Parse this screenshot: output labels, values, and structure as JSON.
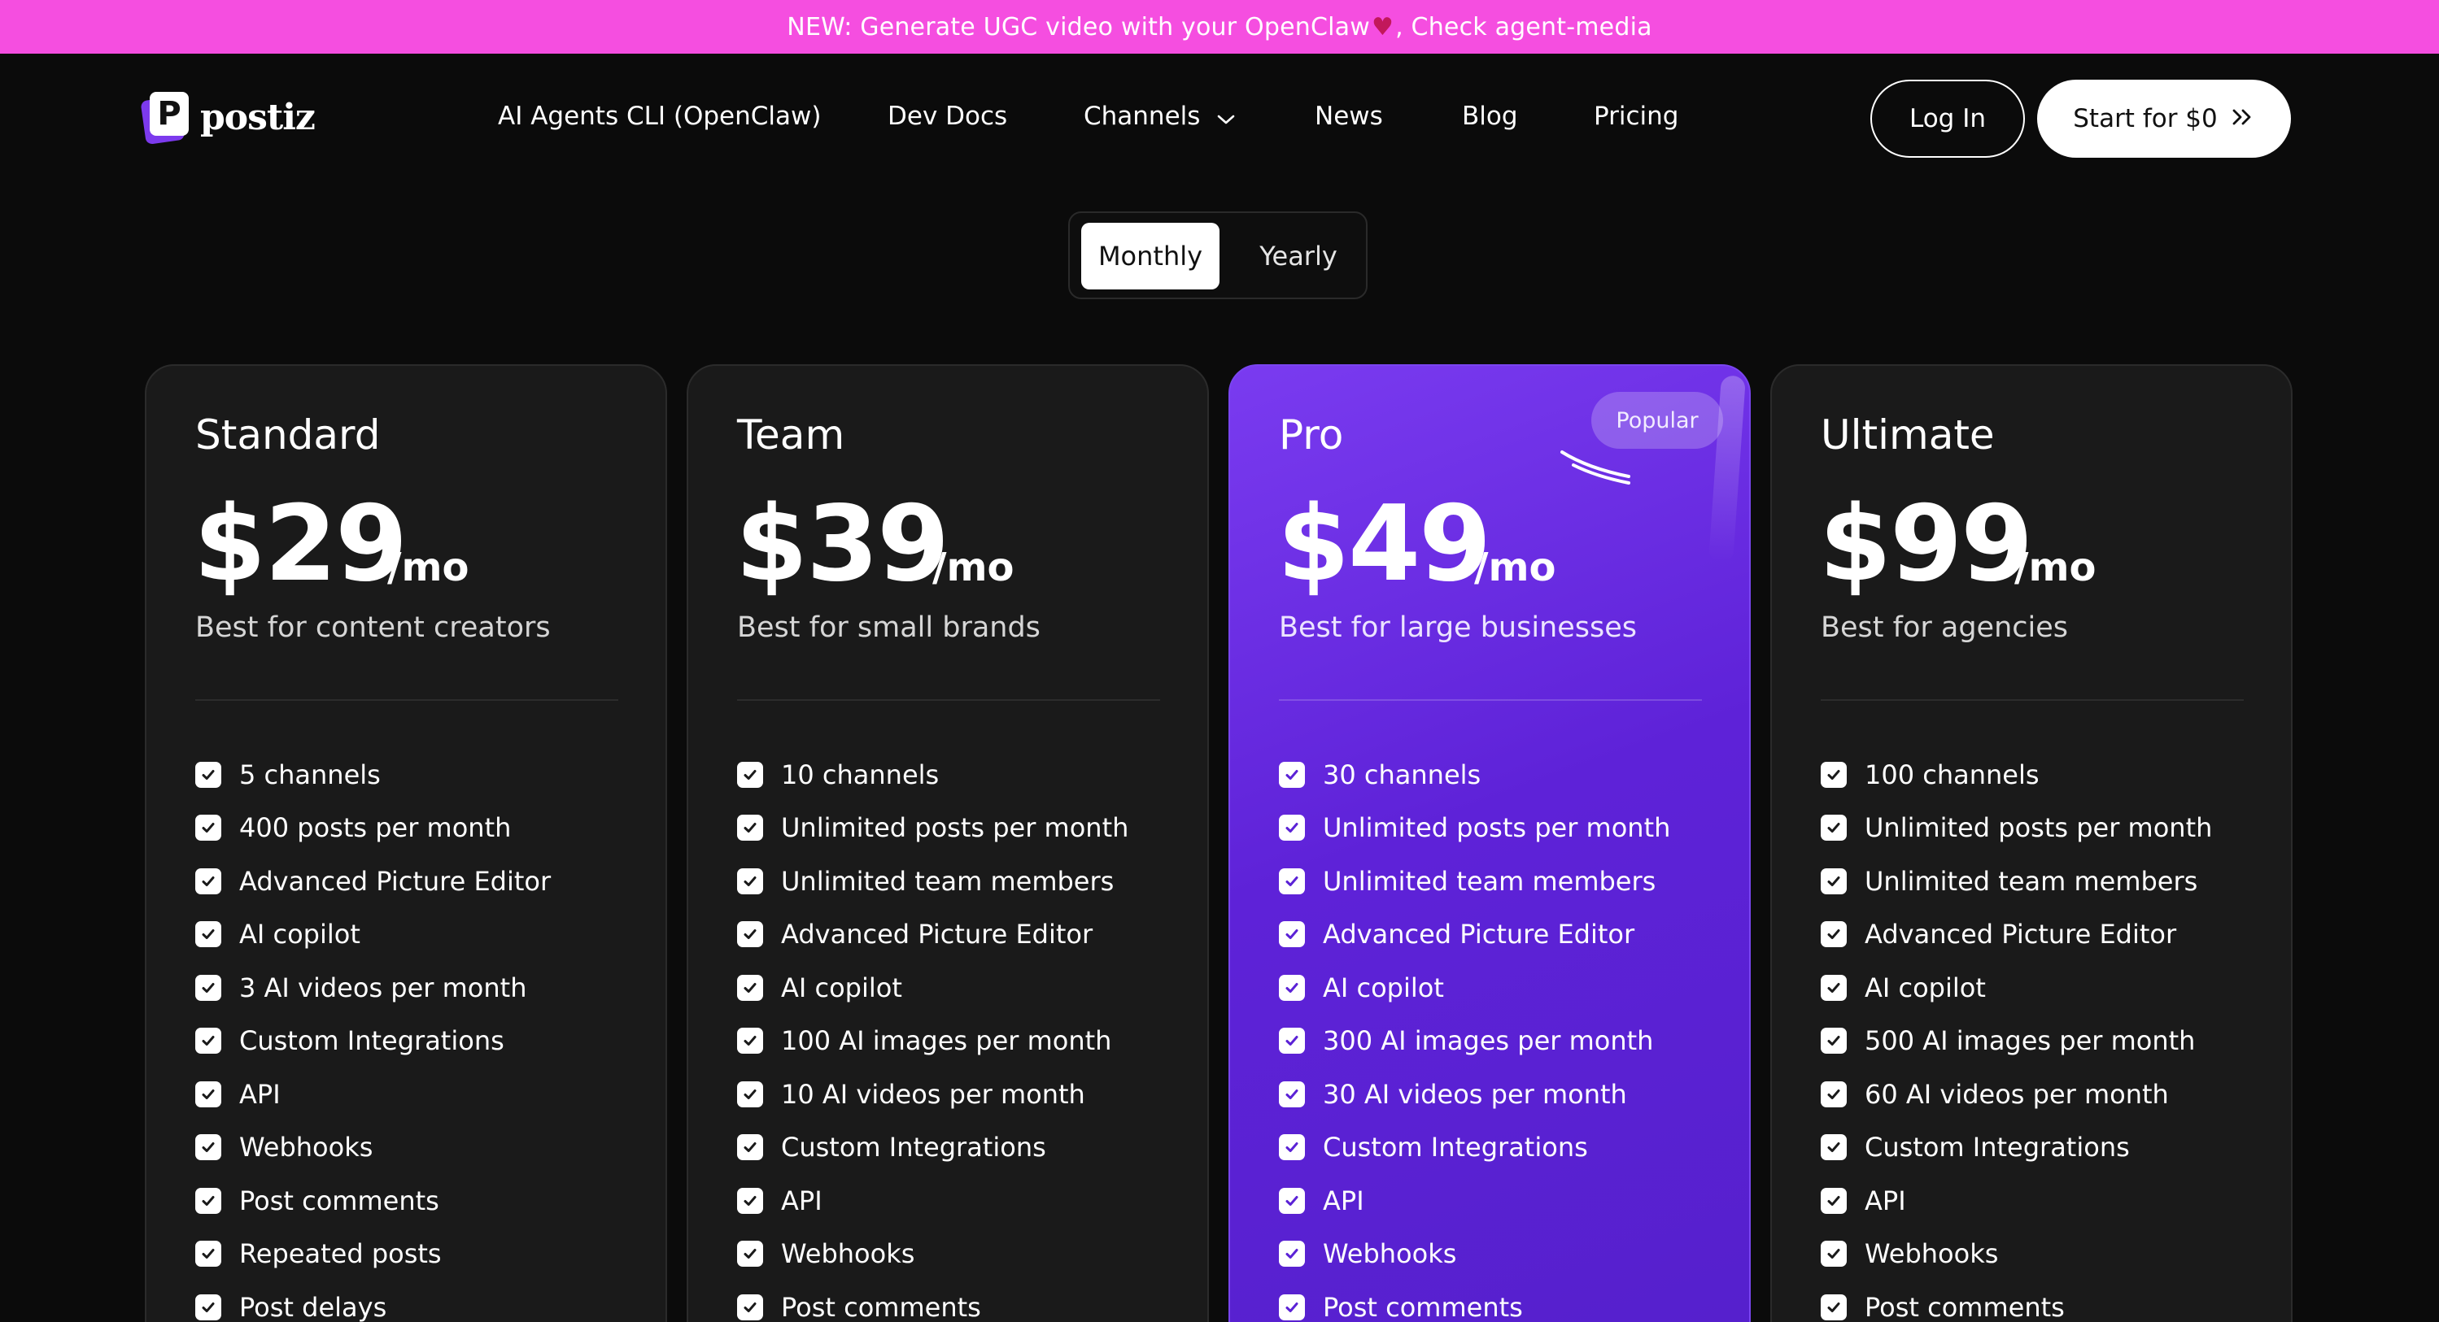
{
  "announcement": {
    "prefix": "NEW: Generate UGC video with your OpenClaw",
    "suffix": ", Check agent-media",
    "icon": "devil-icon"
  },
  "brand": {
    "logo_letter": "P",
    "name": "postiz"
  },
  "nav": {
    "items": [
      {
        "label": "AI Agents CLI (OpenClaw)"
      },
      {
        "label": "Dev Docs"
      },
      {
        "label": "Channels"
      },
      {
        "label": "News"
      },
      {
        "label": "Blog"
      },
      {
        "label": "Pricing"
      }
    ],
    "login": "Log In",
    "start": "Start for $0"
  },
  "billing_toggle": {
    "monthly": "Monthly",
    "yearly": "Yearly",
    "selected": "Monthly"
  },
  "plans": [
    {
      "name": "Standard",
      "price": "$29",
      "period": "/mo",
      "description": "Best for content creators",
      "features": [
        "5 channels",
        "400 posts per month",
        "Advanced Picture Editor",
        "AI copilot",
        "3 AI videos per month",
        "Custom Integrations",
        "API",
        "Webhooks",
        "Post comments",
        "Repeated posts",
        "Post delays"
      ]
    },
    {
      "name": "Team",
      "price": "$39",
      "period": "/mo",
      "description": "Best for small brands",
      "features": [
        "10 channels",
        "Unlimited posts per month",
        "Unlimited team members",
        "Advanced Picture Editor",
        "AI copilot",
        "100 AI images per month",
        "10 AI videos per month",
        "Custom Integrations",
        "API",
        "Webhooks",
        "Post comments"
      ]
    },
    {
      "name": "Pro",
      "price": "$49",
      "period": "/mo",
      "description": "Best for large businesses",
      "badge": "Popular",
      "features": [
        "30 channels",
        "Unlimited posts per month",
        "Unlimited team members",
        "Advanced Picture Editor",
        "AI copilot",
        "300 AI images per month",
        "30 AI videos per month",
        "Custom Integrations",
        "API",
        "Webhooks",
        "Post comments"
      ]
    },
    {
      "name": "Ultimate",
      "price": "$99",
      "period": "/mo",
      "description": "Best for agencies",
      "features": [
        "100 channels",
        "Unlimited posts per month",
        "Unlimited team members",
        "Advanced Picture Editor",
        "AI copilot",
        "500 AI images per month",
        "60 AI videos per month",
        "Custom Integrations",
        "API",
        "Webhooks",
        "Post comments"
      ]
    }
  ],
  "colors": {
    "announcement_bg": "#f54ee0",
    "page_bg": "#0b0b0b",
    "card_bg": "#1a1a1a",
    "pro_accent": "#6a2ee8"
  }
}
